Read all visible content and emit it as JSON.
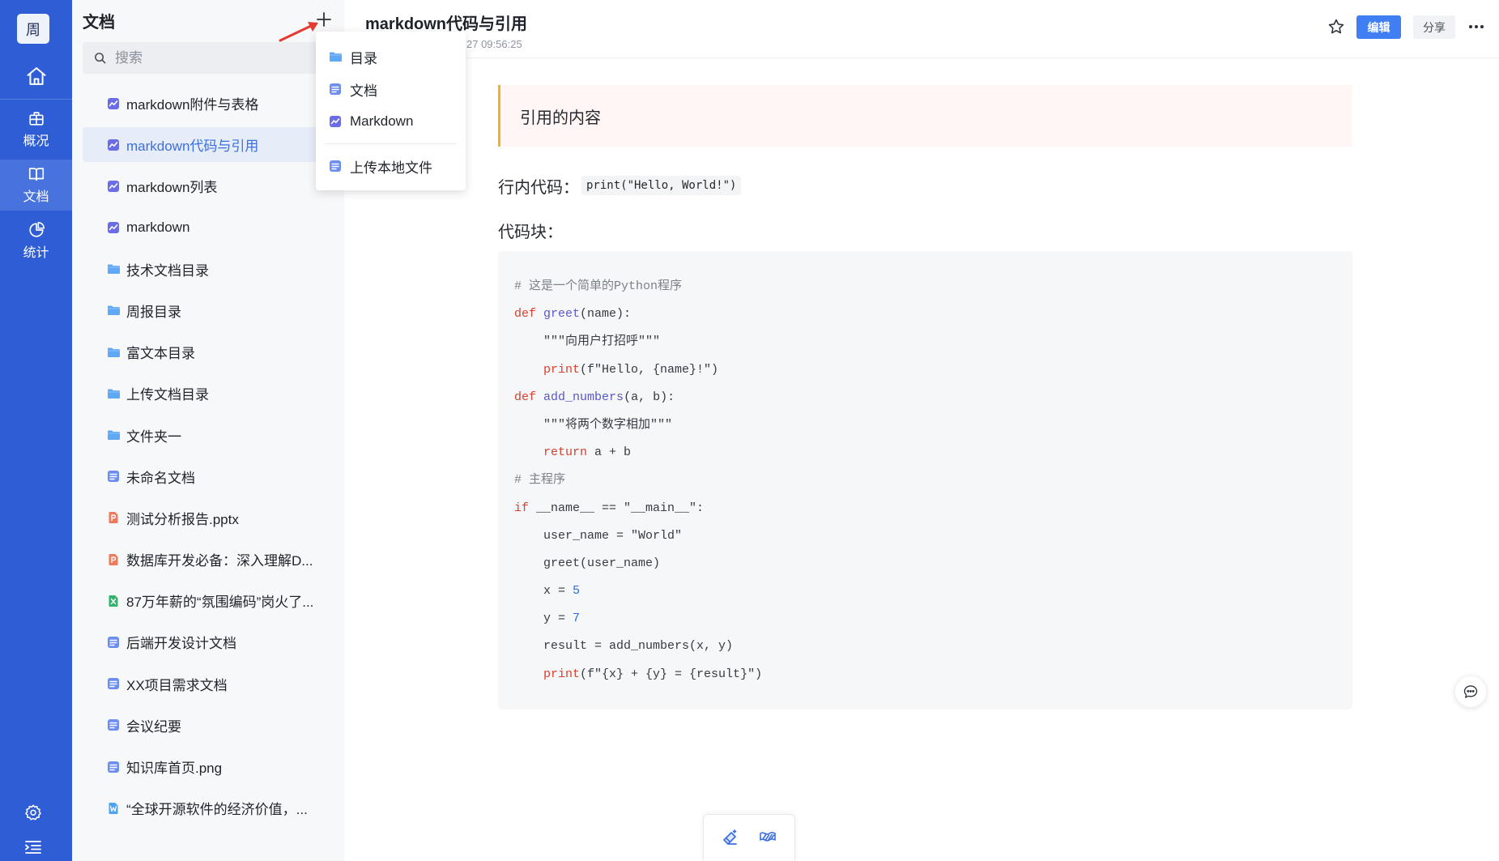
{
  "colors": {
    "rail": "#2f5dd5",
    "rail_active": "#4873de",
    "accent": "#3f7ef3",
    "active_item_text": "#3a6fe0",
    "quote_border": "#f4b41a"
  },
  "rail": {
    "avatar": "周",
    "items": [
      {
        "label": "概况",
        "icon": "overview-icon"
      },
      {
        "label": "文档",
        "icon": "book-icon",
        "active": true
      },
      {
        "label": "统计",
        "icon": "pie-chart-icon"
      }
    ]
  },
  "sidebar": {
    "title": "文档",
    "search_placeholder": "搜索",
    "items": [
      {
        "label": "markdown附件与表格",
        "icon": "markdown-icon"
      },
      {
        "label": "markdown代码与引用",
        "icon": "markdown-icon",
        "active": true
      },
      {
        "label": "markdown列表",
        "icon": "markdown-icon"
      },
      {
        "label": "markdown",
        "icon": "markdown-icon"
      },
      {
        "label": "技术文档目录",
        "icon": "folder-icon"
      },
      {
        "label": "周报目录",
        "icon": "folder-icon"
      },
      {
        "label": "富文本目录",
        "icon": "folder-icon"
      },
      {
        "label": "上传文档目录",
        "icon": "folder-icon"
      },
      {
        "label": "文件夹一",
        "icon": "folder-icon"
      },
      {
        "label": "未命名文档",
        "icon": "doc-icon"
      },
      {
        "label": "测试分析报告.pptx",
        "icon": "ppt-icon"
      },
      {
        "label": "数据库开发必备：深入理解D...",
        "icon": "ppt-icon"
      },
      {
        "label": "87万年薪的“氛围编码”岗火了...",
        "icon": "xls-icon"
      },
      {
        "label": "后端开发设计文档",
        "icon": "doc-icon"
      },
      {
        "label": "XX项目需求文档",
        "icon": "doc-icon"
      },
      {
        "label": "会议纪要",
        "icon": "doc-icon"
      },
      {
        "label": "知识库首页.png",
        "icon": "doc-icon"
      },
      {
        "label": "“全球开源软件的经济价值，...",
        "icon": "word-icon"
      }
    ]
  },
  "dropdown": {
    "items": [
      {
        "label": "目录",
        "icon": "folder-icon"
      },
      {
        "label": "文档",
        "icon": "doc-icon"
      },
      {
        "label": "Markdown",
        "icon": "markdown-icon"
      },
      {
        "label": "上传本地文件",
        "icon": "doc-icon"
      }
    ]
  },
  "header": {
    "title": "markdown代码与引用",
    "timestamp": "27 09:56:25",
    "edit_label": "编辑",
    "share_label": "分享"
  },
  "content": {
    "quote": "引用的内容",
    "inline_label": "行内代码：",
    "inline_code": "print(\"Hello, World!\")",
    "code_label": "代码块：",
    "code_lines": [
      [
        {
          "t": "# 这是一个简单的Python程序",
          "c": "#7b8089"
        }
      ],
      [
        {
          "t": "def",
          "c": "#d8402f"
        },
        {
          "t": " "
        },
        {
          "t": "greet",
          "c": "#5b57c9"
        },
        {
          "t": "(name):"
        }
      ],
      [
        {
          "t": "    \"\"\"向用户打招呼\"\"\""
        }
      ],
      [
        {
          "t": "    "
        },
        {
          "t": "print",
          "c": "#d8402f"
        },
        {
          "t": "(f\"Hello, {name}!\")"
        }
      ],
      [
        {
          "t": "def",
          "c": "#d8402f"
        },
        {
          "t": " "
        },
        {
          "t": "add_numbers",
          "c": "#5b57c9"
        },
        {
          "t": "(a, b):"
        }
      ],
      [
        {
          "t": "    \"\"\"将两个数字相加\"\"\""
        }
      ],
      [
        {
          "t": "    "
        },
        {
          "t": "return",
          "c": "#d8402f"
        },
        {
          "t": " a + b"
        }
      ],
      [
        {
          "t": "# 主程序",
          "c": "#7b8089"
        }
      ],
      [
        {
          "t": "if",
          "c": "#d8402f"
        },
        {
          "t": " __name__ == \"__main__\":"
        }
      ],
      [
        {
          "t": "    user_name = \"World\""
        }
      ],
      [
        {
          "t": "    greet(user_name)"
        }
      ],
      [
        {
          "t": "    x = "
        },
        {
          "t": "5",
          "c": "#2a6fd8"
        }
      ],
      [
        {
          "t": "    y = "
        },
        {
          "t": "7",
          "c": "#2a6fd8"
        }
      ],
      [
        {
          "t": "    result = add_numbers(x, y)"
        }
      ],
      [
        {
          "t": "    "
        },
        {
          "t": "print",
          "c": "#d8402f"
        },
        {
          "t": "(f\"{x} + {y} = {result}\")"
        }
      ]
    ]
  }
}
